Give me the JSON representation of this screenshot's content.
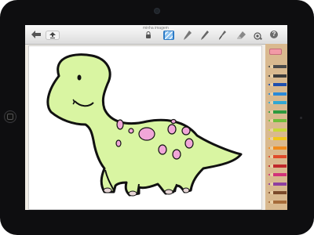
{
  "app": {
    "title": "minha imagem"
  },
  "toolbar": {
    "help_label": "?",
    "tools": [
      {
        "name": "lock",
        "selected": false
      },
      {
        "name": "pattern",
        "selected": true
      },
      {
        "name": "marker",
        "selected": false
      },
      {
        "name": "pencil",
        "selected": false
      },
      {
        "name": "brush",
        "selected": false
      },
      {
        "name": "eraser",
        "selected": false
      },
      {
        "name": "fill",
        "selected": false
      }
    ]
  },
  "colors": {
    "dino_body": "#d9f5a2",
    "dino_spots": "#f0a6d8",
    "selected_tool": "#2d7bc6"
  },
  "pencils": [
    "#4a4a4a",
    "#3b3b3b",
    "#1e4fae",
    "#2b8ad8",
    "#31a7d3",
    "#2d9a3e",
    "#6fbe3b",
    "#c6d83a",
    "#f2c71a",
    "#f08c1e",
    "#e04a2a",
    "#c0282c",
    "#d1337a",
    "#8e3fa0",
    "#7b4a2a",
    "#a56b3a"
  ]
}
